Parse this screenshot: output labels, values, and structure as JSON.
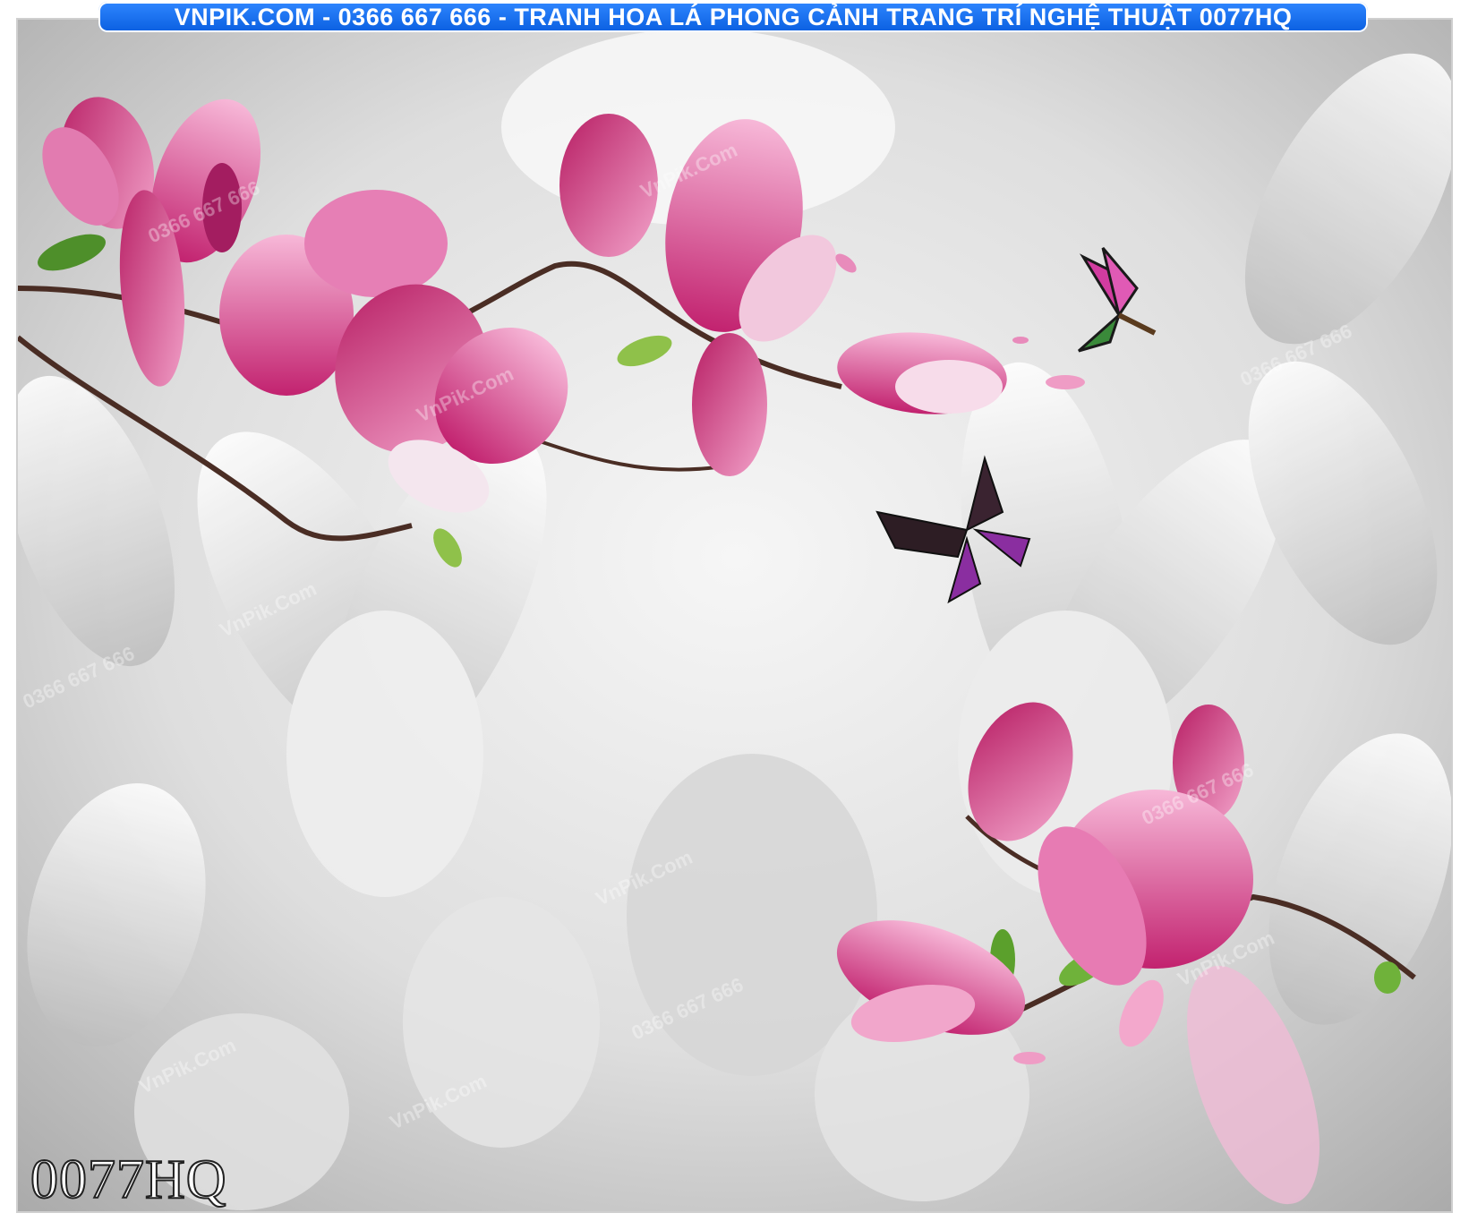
{
  "banner": {
    "text": "VNPIK.COM - 0366 667 666 - TRANH HOA LÁ PHONG CẢNH TRANG TRÍ NGHỆ THUẬT 0077HQ"
  },
  "product_code": "0077HQ",
  "watermark": {
    "site": "VnPik.Com",
    "phone": "0366 667 666"
  },
  "colors": {
    "banner": "#0a5fe0",
    "flower": "#d63a8e",
    "background": "#d8d8d8"
  }
}
